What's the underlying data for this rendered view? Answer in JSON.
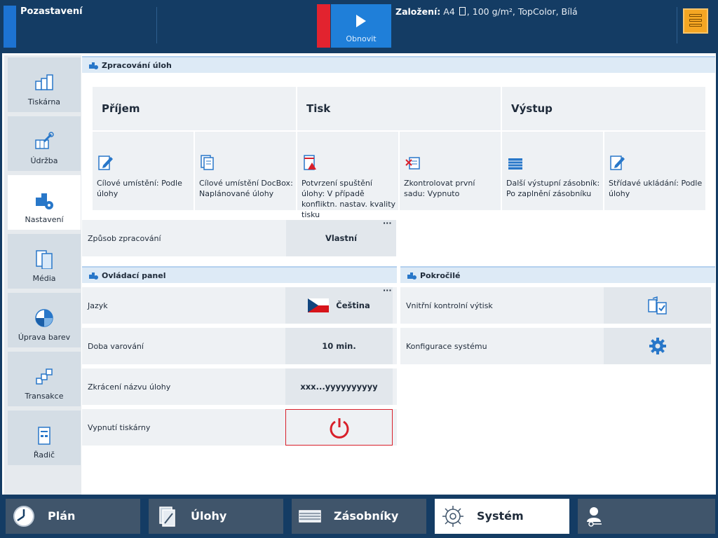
{
  "topbar": {
    "status": "Pozastavení",
    "resume_label": "Obnovit",
    "media_prefix": "Založení:",
    "media_size": "A4",
    "media_details": ", 100 g/m², TopColor, Bílá"
  },
  "sidebar": {
    "items": [
      {
        "label": "Tiskárna"
      },
      {
        "label": "Údržba"
      },
      {
        "label": "Nastavení"
      },
      {
        "label": "Média"
      },
      {
        "label": "Úprava barev"
      },
      {
        "label": "Transakce"
      },
      {
        "label": "Řadič"
      }
    ]
  },
  "processing": {
    "title": "Zpracování úloh",
    "columns": [
      "Příjem",
      "Tisk",
      "Výstup"
    ],
    "tiles": [
      "Cílové umístění: Podle úlohy",
      "Cílové umístění DocBox: Naplánované úlohy",
      "Potvrzení spuštění úlohy: V případě konfliktn. nastav. kvality tisku",
      "Zkontrolovat první sadu: Vypnuto",
      "Další výstupní zásobník: Po zaplnění zásobníku",
      "Střídavé ukládání: Podle úlohy"
    ],
    "method_label": "Způsob zpracování",
    "method_value": "Vlastní",
    "more": "···"
  },
  "control_panel": {
    "title": "Ovládací panel",
    "more": "···",
    "rows": [
      {
        "label": "Jazyk",
        "value": "Čeština"
      },
      {
        "label": "Doba varování",
        "value": "10 min."
      },
      {
        "label": "Zkrácení názvu úlohy",
        "value": "xxx...yyyyyyyyyy"
      },
      {
        "label": "Vypnutí tiskárny",
        "value": ""
      }
    ]
  },
  "advanced": {
    "title": "Pokročilé",
    "rows": [
      {
        "label": "Vnitřní kontrolní výtisk"
      },
      {
        "label": "Konfigurace systému"
      }
    ]
  },
  "bottombar": {
    "items": [
      {
        "label": "Plán"
      },
      {
        "label": "Úlohy"
      },
      {
        "label": "Zásobníky"
      },
      {
        "label": "Systém"
      },
      {
        "label": ""
      }
    ]
  },
  "colors": {
    "bar": "#143c64",
    "accent": "#1f7fd9",
    "stop": "#e2232f",
    "power": "#d81f2a",
    "warning": "#f5a623"
  }
}
